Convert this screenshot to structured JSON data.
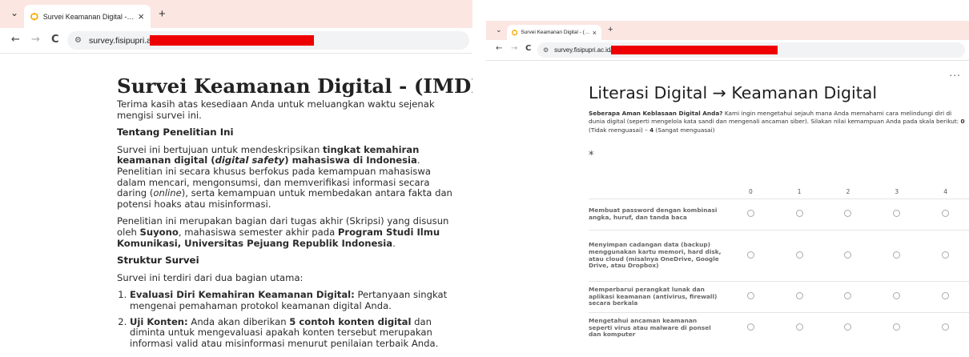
{
  "left": {
    "tab": {
      "title": "Survei Keamanan Digital - (IMD",
      "close": "×",
      "new_tab": "+",
      "menu": "⌄"
    },
    "url": "survey.fisipupri.ac.id/",
    "title": "Survei Keamanan Digital - (IMDI)",
    "intro": "Terima kasih atas kesediaan Anda untuk meluangkan waktu sejenak mengisi survei ini.",
    "about_heading": "Tentang Penelitian Ini",
    "about_p1": {
      "a": "Survei ini bertujuan untuk mendeskripsikan ",
      "b": "tingkat kemahiran keamanan digital (",
      "c": "digital safety",
      "d": ") mahasiswa di Indonesia",
      "e": ". Penelitian ini secara khusus berfokus pada kemampuan mahasiswa dalam mencari, mengonsumsi, dan memverifikasi informasi secara daring (",
      "f": "online",
      "g": "), serta kemampuan untuk membedakan antara fakta dan potensi hoaks atau misinformasi."
    },
    "about_p2": {
      "a": "Penelitian ini merupakan bagian dari tugas akhir (Skripsi) yang disusun oleh ",
      "b": "Suyono",
      "c": ", mahasiswa semester akhir pada ",
      "d": "Program Studi Ilmu Komunikasi, Universitas Pejuang Republik Indonesia",
      "e": "."
    },
    "structure_heading": "Struktur Survei",
    "structure_intro": "Survei ini terdiri dari dua bagian utama:",
    "list": [
      {
        "bold": "Evaluasi Diri Kemahiran Keamanan Digital:",
        "rest": " Pertanyaan singkat mengenai pemahaman protokol keamanan digital Anda."
      },
      {
        "bold": "Uji Konten:",
        "mid": " Anda akan diberikan ",
        "bold2": "5 contoh konten digital",
        "rest": " dan diminta untuk mengevaluasi apakah konten tersebut merupakan informasi valid atau misinformasi menurut penilaian terbaik Anda."
      }
    ]
  },
  "right": {
    "tab": {
      "title": "Survei Keamanan Digital - (IMD",
      "close": "×",
      "new_tab": "+",
      "menu": "⌄"
    },
    "url": "survey.fisipupri.ac.id/",
    "more": "...",
    "title": "Literasi Digital → Keamanan Digital",
    "desc": {
      "bold": "Seberapa Aman Keblasaan Digital Anda?",
      "text": " Kami ingin mengetahui sejauh mana Anda memahami cara melindungi diri di dunia digital (seperti mengelola kata sandi dan mengenali ancaman siber). Silakan nilai kemampuan Anda pada skala berikut: ",
      "b0": "0",
      "t0": " (Tidak menguasai) – ",
      "b4": "4",
      "t4": " (Sangat menguasai)"
    },
    "required_mark": "*",
    "scale": [
      "0",
      "1",
      "2",
      "3",
      "4"
    ],
    "statements": [
      "Membuat password dengan kombinasi angka, huruf, dan tanda baca",
      "Menyimpan cadangan data (backup) menggunakan kartu memori, hard disk, atau cloud (misalnya OneDrive, Google Drive, atau Dropbox)",
      "Memperbarui perangkat lunak dan aplikasi keamanan (antivirus, firewall) secara berkala",
      "Mengetahui ancaman keamanan seperti virus atau malware di ponsel dan komputer"
    ]
  },
  "icons": {
    "back": "←",
    "forward": "→",
    "reload": "C",
    "site_info": "⚙"
  },
  "colors": {
    "tab_strip": "#fbe6e2",
    "redaction": "#ee0000",
    "favicon": "#f7a600"
  }
}
